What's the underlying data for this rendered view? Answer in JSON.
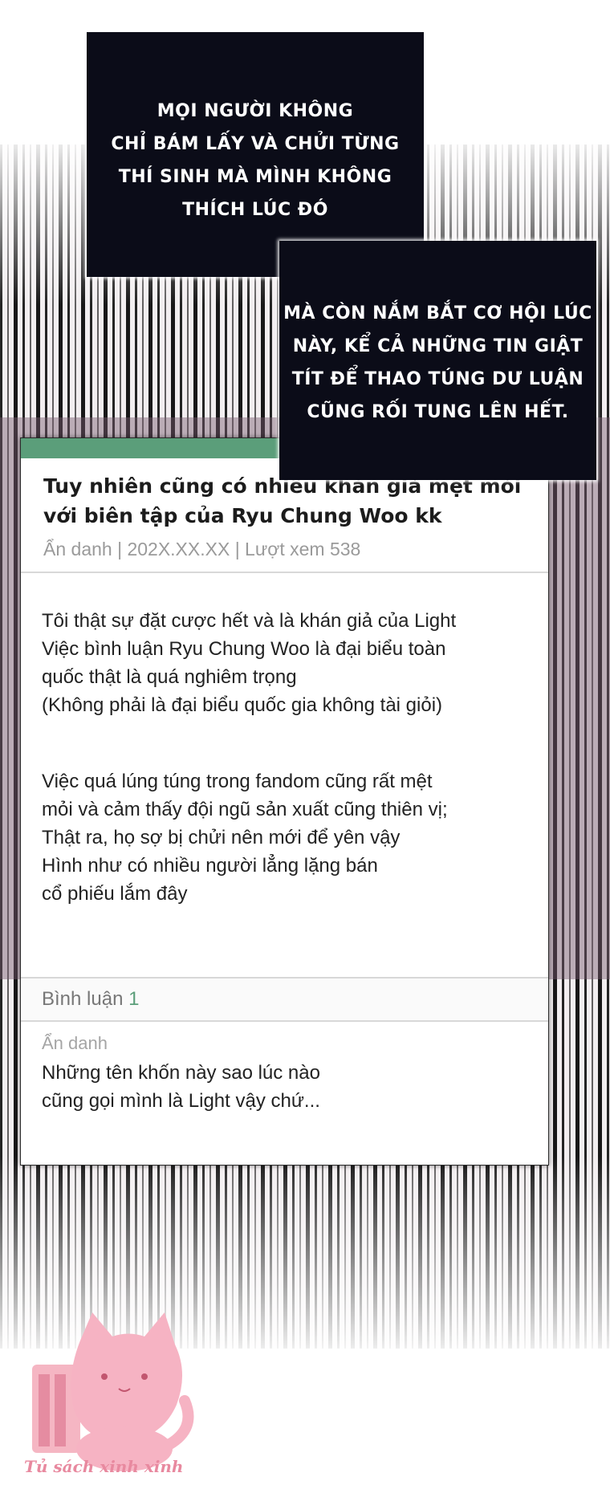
{
  "captions": {
    "first": [
      "MỌI NGƯỜI KHÔNG",
      "CHỈ BÁM LẤY VÀ CHỬI TỪNG",
      "THÍ SINH MÀ MÌNH KHÔNG",
      "THÍCH LÚC ĐÓ"
    ],
    "second": [
      "MÀ CÒN NẮM BẮT CƠ HỘI LÚC",
      "NÀY, KỂ CẢ NHỮNG TIN GIẬT",
      "TÍT ĐỂ THAO TÚNG DƯ LUẬN",
      "CŨNG RỐI TUNG LÊN HẾT."
    ]
  },
  "post": {
    "title": "Tuy nhiên cũng có nhiều khán giả mệt mỏi với biên tập của Ryu Chung Woo kk",
    "meta": "Ẩn danh | 202X.XX.XX | Lượt xem 538",
    "paragraph1": [
      "Tôi thật sự đặt cược hết và là khán giả của Light",
      "Việc bình luận Ryu Chung Woo là đại biểu toàn",
      "quốc thật là quá nghiêm trọng",
      "(Không phải là đại biểu quốc gia không tài giỏi)"
    ],
    "paragraph2": [
      "Việc quá lúng túng trong fandom cũng rất mệt",
      "mỏi và cảm thấy đội ngũ sản xuất cũng thiên vị;",
      "Thật ra, họ sợ bị chửi nên mới để yên vậy",
      "Hình như có nhiều người lẳng lặng bán",
      "cổ phiếu lắm đây"
    ],
    "comments_label": "Bình luận",
    "comments_count": "1",
    "comment": {
      "author": "Ẩn danh",
      "text": [
        "Những tên khốn này sao lúc nào",
        "cũng gọi mình là Light vậy chứ..."
      ]
    }
  },
  "watermark": {
    "label": "Tủ sách xinh xinh",
    "icon": "pink-cat-books-logo",
    "color": "#e8899f"
  },
  "colors": {
    "accent": "#5b9e7a",
    "caption_bg": "#0b0c18"
  }
}
